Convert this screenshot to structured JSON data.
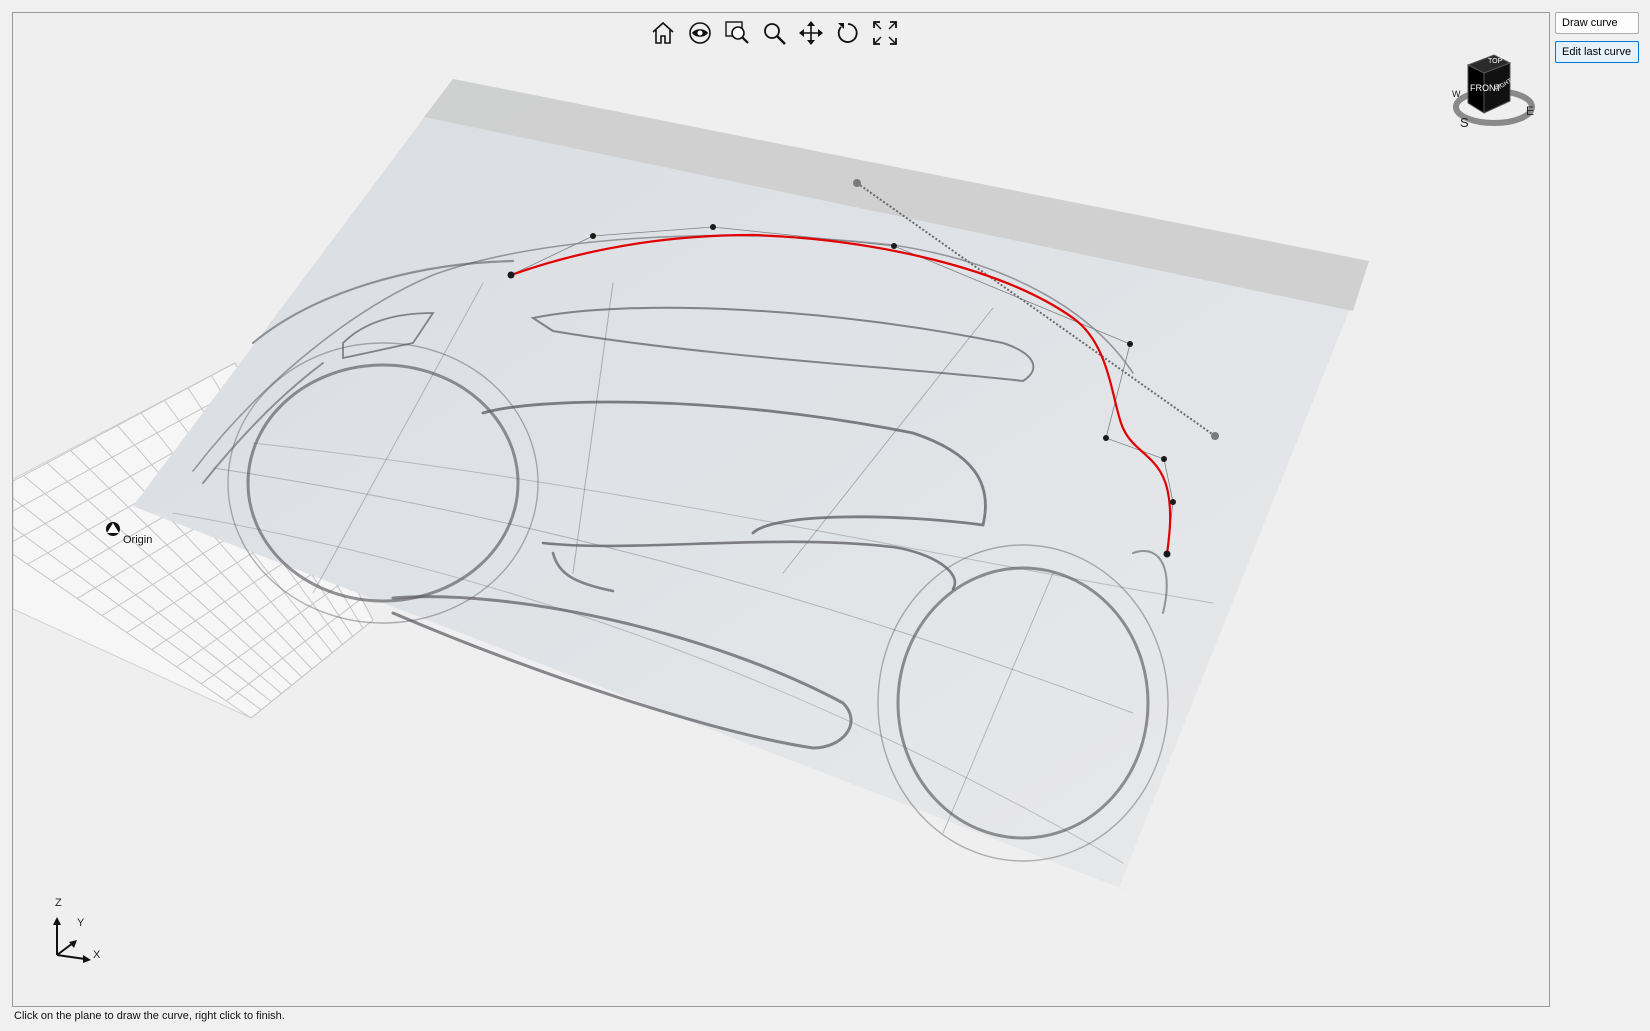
{
  "toolbar": {
    "items": [
      {
        "name": "home",
        "icon": "home-icon"
      },
      {
        "name": "look",
        "icon": "eye-icon"
      },
      {
        "name": "zoom-window",
        "icon": "zoom-window-icon"
      },
      {
        "name": "zoom",
        "icon": "magnifier-icon"
      },
      {
        "name": "pan",
        "icon": "pan-arrows-icon"
      },
      {
        "name": "orbit",
        "icon": "orbit-icon"
      },
      {
        "name": "fit-all",
        "icon": "fullscreen-icon"
      }
    ]
  },
  "viewcube": {
    "front": "FRONT",
    "top": "TOP",
    "right": "RIGHT",
    "compass": {
      "south": "S",
      "east": "E",
      "west": "W"
    }
  },
  "scene": {
    "origin_label": "Origin",
    "active_curve_color": "#e00000"
  },
  "axis_triad": {
    "x": "X",
    "y": "Y",
    "z": "Z"
  },
  "panel": {
    "draw_curve": "Draw curve",
    "edit_last_curve": "Edit last curve"
  },
  "status": {
    "message": "Click on the plane to draw the curve, right click to finish."
  }
}
